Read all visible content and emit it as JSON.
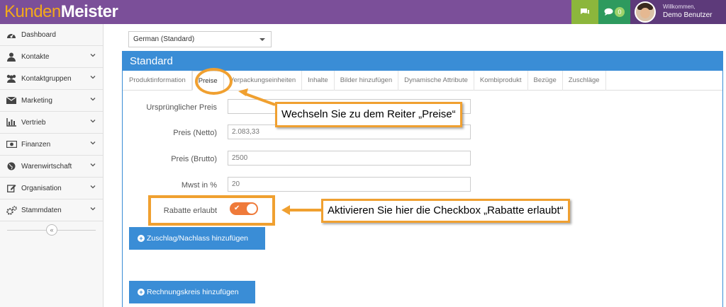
{
  "header": {
    "logo_part1": "Kunden",
    "logo_part2": "Meister",
    "message_count": "0",
    "welcome": "Willkommen,",
    "user_name": "Demo Benutzer"
  },
  "sidebar": {
    "items": [
      {
        "label": "Dashboard",
        "icon": "dashboard-icon"
      },
      {
        "label": "Kontakte",
        "icon": "user-icon"
      },
      {
        "label": "Kontaktgruppen",
        "icon": "users-icon"
      },
      {
        "label": "Marketing",
        "icon": "envelope-icon"
      },
      {
        "label": "Vertrieb",
        "icon": "bar-chart-icon"
      },
      {
        "label": "Finanzen",
        "icon": "money-icon"
      },
      {
        "label": "Warenwirtschaft",
        "icon": "globe-icon"
      },
      {
        "label": "Organisation",
        "icon": "edit-icon"
      },
      {
        "label": "Stammdaten",
        "icon": "cogs-icon"
      }
    ],
    "collapse_glyph": "«"
  },
  "language": {
    "selected": "German (Standard)"
  },
  "panel": {
    "title": "Standard",
    "tabs": [
      "Produktinformation",
      "Preise",
      "Verpackungseinheiten",
      "Inhalte",
      "Bilder hinzufügen",
      "Dynamische Attribute",
      "Kombiprodukt",
      "Bezüge",
      "Zuschläge"
    ],
    "active_tab": "Preise"
  },
  "form": {
    "original_price_label": "Ursprünglicher Preis",
    "original_price_value": "",
    "net_price_label": "Preis (Netto)",
    "net_price_value": "2.083,33",
    "gross_price_label": "Preis (Brutto)",
    "gross_price_value": "2500",
    "vat_label": "Mwst in %",
    "vat_value": "20",
    "discount_label": "Rabatte erlaubt",
    "discount_enabled": true
  },
  "buttons": {
    "surcharge": "Zuschlag/Nachlass hinzufügen",
    "billing_group": "Rechnungskreis hinzufügen"
  },
  "annotations": {
    "tab_hint": "Wechseln Sie zu dem Reiter „Preise“",
    "checkbox_hint": "Aktivieren Sie hier die Checkbox „Rabatte erlaubt“"
  },
  "colors": {
    "header": "#7b4f99",
    "primary": "#3a8dd6",
    "toggle_on": "#ef7a3a",
    "annotation": "#f0a030"
  }
}
